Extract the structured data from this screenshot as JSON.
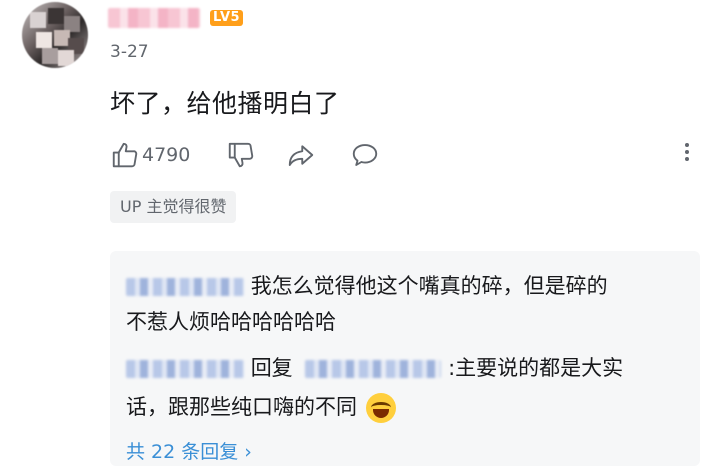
{
  "comment": {
    "level_badge": "LV5",
    "date": "3-27",
    "text": "坏了，给他播明白了",
    "like_count": "4790",
    "up_badge": "UP 主觉得很赞"
  },
  "replies": {
    "reply1_text_line1": "我怎么觉得他这个嘴真的碎，但是碎的",
    "reply1_text_line2": "不惹人烦哈哈哈哈哈哈",
    "reply2_reply_word": "回复",
    "reply2_text_line1": ":主要说的都是大实",
    "reply2_text_line2": "话，跟那些纯口嗨的不同",
    "more_replies": "共 22 条回复 ›"
  },
  "icons": [
    "avatar",
    "thumb-up-icon",
    "thumb-down-icon",
    "share-icon",
    "reply-icon",
    "more-icon",
    "laughing-emoji-icon"
  ],
  "colors": {
    "level_badge": "#ff9f1a",
    "link_blue": "#3a8fd6",
    "muted": "#61666d",
    "reply_bg": "#f6f7f8"
  }
}
